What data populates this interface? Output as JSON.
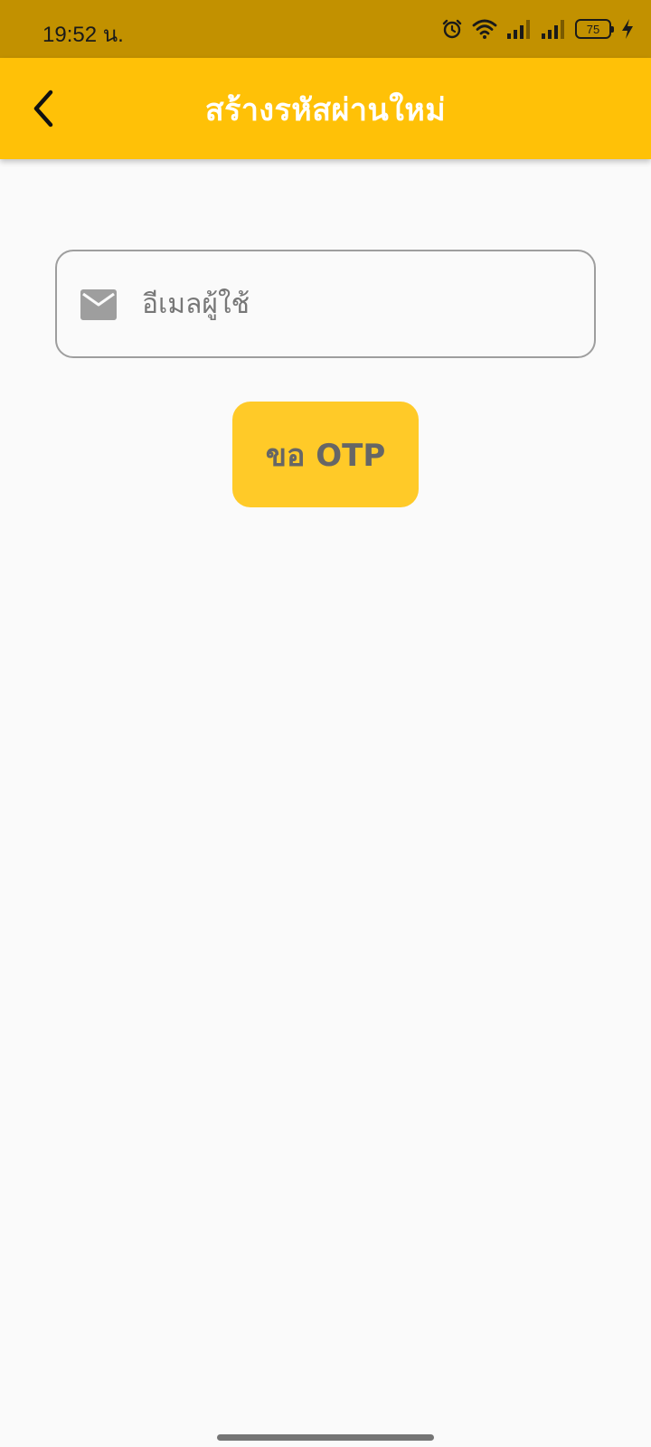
{
  "status_bar": {
    "time": "19:52 น.",
    "battery_level": "75",
    "icons": [
      "alarm-icon",
      "wifi-icon",
      "signal-icon",
      "signal-icon",
      "battery-icon",
      "charging-icon"
    ]
  },
  "app_bar": {
    "title": "สร้างรหัสผ่านใหม่",
    "back_icon": "chevron-left-icon",
    "background_color": "#ffc107"
  },
  "email_field": {
    "placeholder": "อีเมลผู้ใช้",
    "value": "",
    "icon": "mail-icon"
  },
  "otp_button": {
    "label": "ขอ OTP",
    "background_color": "#ffca28"
  },
  "colors": {
    "status_bar": "#c29100",
    "accent": "#ffc107",
    "background": "#fafafa"
  }
}
